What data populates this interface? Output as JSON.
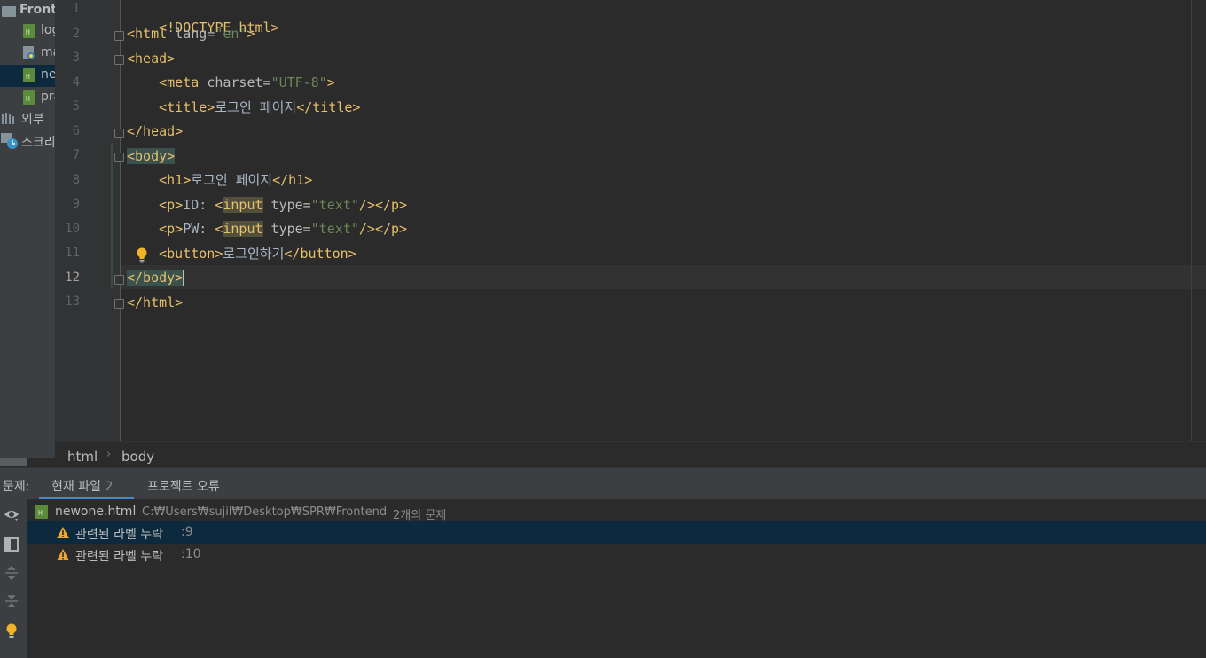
{
  "project_tree": {
    "root_label": "Front",
    "items": [
      {
        "label": "log",
        "icon": "html-file-icon",
        "selected": false
      },
      {
        "label": "ma",
        "icon": "python-file-icon",
        "selected": false
      },
      {
        "label": "ne",
        "icon": "html-file-icon",
        "selected": true
      },
      {
        "label": "pra",
        "icon": "html-file-icon",
        "selected": false
      },
      {
        "label": "외부 ",
        "icon": "library-icon",
        "selected": false
      },
      {
        "label": "스크리",
        "icon": "scratch-icon",
        "selected": false
      }
    ]
  },
  "editor": {
    "line_numbers": [
      "1",
      "2",
      "3",
      "4",
      "5",
      "6",
      "7",
      "8",
      "9",
      "10",
      "11",
      "12",
      "13"
    ],
    "current_line": "12",
    "lines": {
      "l1": "<!DOCTYPE html>",
      "l2_open": "<html ",
      "l2_attr": "lang=",
      "l2_val": "\"en\"",
      "l2_close": ">",
      "l3": "<head>",
      "l4_open": "<meta ",
      "l4_attr": "charset=",
      "l4_val": "\"UTF-8\"",
      "l4_close": ">",
      "l5_open": "<title>",
      "l5_text": "로그인 페이지",
      "l5_close": "</title>",
      "l6": "</head>",
      "l7": "<body>",
      "l8_open": "<h1>",
      "l8_text": "로그인 페이지",
      "l8_close": "</h1>",
      "l9_p": "<p>",
      "l9_text": "ID: ",
      "l9_lt": "<",
      "l9_input": "input",
      "l9_attr": " type=",
      "l9_val": "\"text\"",
      "l9_end": "/></p>",
      "l10_p": "<p>",
      "l10_text": "PW: ",
      "l10_lt": "<",
      "l10_input": "input",
      "l10_attr": " type=",
      "l10_val": "\"text\"",
      "l10_end": "/></p>",
      "l11_open": "<button>",
      "l11_text": "로그인하기",
      "l11_close": "</button>",
      "l12": "</body>",
      "l13": "</html>"
    }
  },
  "breadcrumb": [
    "html",
    "body"
  ],
  "problems": {
    "header_label": "문제:",
    "tabs": [
      {
        "label": "현재 파일",
        "count": "2",
        "active": true
      },
      {
        "label": "프로젝트 오류",
        "count": "",
        "active": false
      }
    ],
    "file": {
      "name": "newone.html",
      "path": "C:₩Users₩sujil₩Desktop₩SPR₩Frontend",
      "summary": "2개의 문제"
    },
    "items": [
      {
        "message": "관련된 라벨 누락",
        "location": ":9",
        "severity": "warning",
        "selected": true
      },
      {
        "message": "관련된 라벨 누락",
        "location": ":10",
        "severity": "warning",
        "selected": false
      }
    ]
  },
  "colors": {
    "tag": "#e8bf6a",
    "string": "#6a8759",
    "selection": "#0d293e",
    "accent": "#4a88c7"
  }
}
